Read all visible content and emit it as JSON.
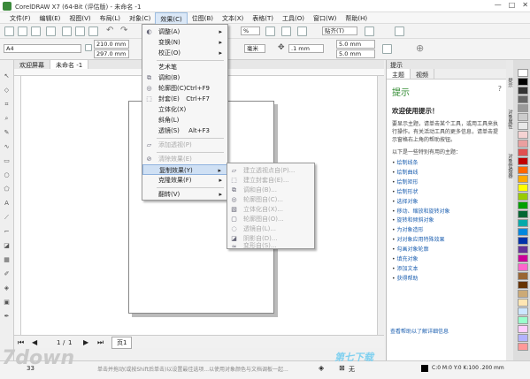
{
  "window": {
    "title": "CorelDRAW X7 (64-Bit (评估版) - 未命名 -1",
    "min": "—",
    "max": "□",
    "close": "✕"
  },
  "menubar": [
    "文件(F)",
    "编辑(E)",
    "视图(V)",
    "布局(L)",
    "对象(C)",
    "效果(C)",
    "位图(B)",
    "文本(X)",
    "表格(T)",
    "工具(O)",
    "窗口(W)",
    "帮助(H)"
  ],
  "toolbar": {
    "zoom": "%",
    "snap": "贴齐(T)"
  },
  "property_bar": {
    "paper": "A4",
    "width": "210.0 mm",
    "height": "297.0 mm",
    "units": "毫米",
    "nudge": ".1 mm",
    "dup_x": "5.0 mm",
    "dup_y": "5.0 mm"
  },
  "doc_tabs": [
    "欢迎屏幕",
    "未命名 -1"
  ],
  "effects_menu": {
    "items": [
      {
        "label": "调整(A)",
        "arrow": "▸",
        "enabled": true
      },
      {
        "label": "变换(N)",
        "arrow": "▸",
        "enabled": true
      },
      {
        "label": "校正(O)",
        "arrow": "▸",
        "enabled": true
      },
      {
        "label": "艺术笔",
        "enabled": true
      },
      {
        "label": "调和(B)",
        "enabled": true
      },
      {
        "label": "轮廓图(C)",
        "shortcut": "Ctrl+F9",
        "enabled": true
      },
      {
        "label": "封套(E)",
        "shortcut": "Ctrl+F7",
        "enabled": true
      },
      {
        "label": "立体化(X)",
        "enabled": true
      },
      {
        "label": "斜角(L)",
        "enabled": true
      },
      {
        "label": "透镜(S)",
        "shortcut": "Alt+F3",
        "enabled": true
      },
      {
        "label": "添加透视(P)",
        "enabled": false
      },
      {
        "label": "清除效果(E)",
        "enabled": false
      },
      {
        "label": "复制效果(Y)",
        "arrow": "▸",
        "enabled": true,
        "highlight": true
      },
      {
        "label": "克隆效果(F)",
        "arrow": "▸",
        "enabled": true
      },
      {
        "label": "翻转(V)",
        "arrow": "▸",
        "enabled": true
      }
    ]
  },
  "copy_submenu": [
    "建立透视点自(P)...",
    "建立封套自(E)...",
    "调和自(B)...",
    "轮廓图自(C)...",
    "立体化自(X)...",
    "轮廓图自(O)...",
    "透镜自(L)...",
    "阴影自(D)...",
    "变形自(S)..."
  ],
  "page_nav": {
    "current": "1",
    "sep": "/",
    "total": "1",
    "page_tab": "页1"
  },
  "status": {
    "coords": "33",
    "hint": "单击并拖动(或按Shift后单击)以设置最佳选项...以使用对象颜色与文档调板一起...",
    "fill": "无",
    "color_info": "C:0 M:0 Y:0 K:100 .200 mm"
  },
  "hints_panel": {
    "header": "提示",
    "tabs": [
      "主题",
      "视频"
    ],
    "title": "提示",
    "welcome": "欢迎使用提示！",
    "description": "要显示主题，请单击某个工具，或用工具来执行操作。有关活动工具的更多信息，请单击提示窗格右上角的帮助按钮。",
    "list_intro": "以下是一些特别有用的主题：",
    "links": [
      "绘制线条",
      "绘制曲线",
      "绘制矩形",
      "绘制形状",
      "选择对象",
      "移动、缩放和旋转对象",
      "旋转和倾斜对象",
      "为对象造形",
      "对对象应用特殊效果",
      "勾画对象轮廓",
      "填充对象",
      "添加文本",
      "获得帮助"
    ],
    "footer": "查看帮助以了解详细信息"
  },
  "side_tabs": [
    "提示",
    "对象属性",
    "对象管理器"
  ],
  "palette_colors": [
    "#ffffff",
    "#000000",
    "#333333",
    "#666666",
    "#999999",
    "#cccccc",
    "#e8e8e8",
    "#f5d3d3",
    "#eaa0a0",
    "#e05050",
    "#c00000",
    "#ff6600",
    "#ffaa00",
    "#ffff00",
    "#99cc00",
    "#00a000",
    "#006633",
    "#00aaaa",
    "#0088dd",
    "#0033aa",
    "#663399",
    "#cc0099",
    "#ff66cc",
    "#996633",
    "#663300",
    "#ccaa77",
    "#ffe6b3",
    "#cce6ff",
    "#99ffcc",
    "#ffccff",
    "#b3b3ff",
    "#ff9999"
  ],
  "watermark": {
    "left": "7down",
    "right": "第七下载"
  }
}
